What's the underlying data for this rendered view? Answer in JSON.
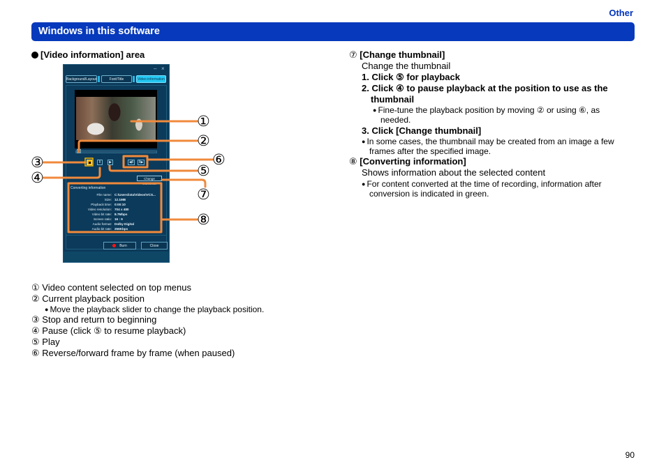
{
  "header": {
    "section": "Other",
    "title": "Windows in this software"
  },
  "area_title": "[Video information] area",
  "window": {
    "minimize_icon": "–",
    "close_icon": "×",
    "tabs": [
      {
        "label": "Background/Layout",
        "active": false
      },
      {
        "label": "Font/Title",
        "active": false
      },
      {
        "label": "Video information",
        "active": true
      }
    ],
    "controls": {
      "stop": "■",
      "pause": "II",
      "play": "▶",
      "reverse_frame": "◀II",
      "forward_frame": "II▶"
    },
    "change_thumbnail_label": "Change thumbnail",
    "converting_info": {
      "title": "Converting information",
      "rows": [
        {
          "label": "File name:",
          "value": "C:\\Users\\ista\\Videos\\VCS..."
        },
        {
          "label": "Size:",
          "value": "12.1MB"
        },
        {
          "label": "Playback time:",
          "value": "0:00:10"
        },
        {
          "label": "Video resolution:",
          "value": "704 x 480"
        },
        {
          "label": "Video bit rate:",
          "value": "8.7Mbps"
        },
        {
          "label": "Screen ratio:",
          "value": "16 : 9"
        },
        {
          "label": "Audio format:",
          "value": "Dolby Digital"
        },
        {
          "label": "Audio bit rate:",
          "value": "256Kbps"
        }
      ]
    },
    "burn_label": "Burn",
    "close_label": "Close"
  },
  "callout_numbers": [
    "①",
    "②",
    "③",
    "④",
    "⑤",
    "⑥",
    "⑦",
    "⑧"
  ],
  "legend_left": [
    {
      "num": "①",
      "text": "Video content selected on top menus"
    },
    {
      "num": "②",
      "text": "Current playback position"
    },
    {
      "bullet": "Move the playback slider to change the playback position."
    },
    {
      "num": "③",
      "text": "Stop and return to beginning"
    },
    {
      "num": "④",
      "text": "Pause (click ⑤ to resume playback)"
    },
    {
      "num": "⑤",
      "text": "Play"
    },
    {
      "num": "⑥",
      "text": "Reverse/forward frame by frame (when paused)"
    }
  ],
  "right_column": {
    "item7": {
      "num": "⑦",
      "title": "[Change thumbnail]",
      "desc": "Change the thumbnail",
      "steps": [
        "1. Click ⑤ for playback",
        "2. Click ④ to pause playback at the position to use as the",
        "thumbnail",
        "3. Click [Change thumbnail]"
      ],
      "step2_note_line1": "Fine-tune the playback position by moving ② or using ⑥, as",
      "step2_note_line2": "needed.",
      "step3_note_line1": "In some cases, the thumbnail may be created from an image a few",
      "step3_note_line2": "frames after the specified image."
    },
    "item8": {
      "num": "⑧",
      "title": "[Converting information]",
      "desc": "Shows information about the selected content",
      "note_line1": "For content converted at the time of recording, information after",
      "note_line2": "conversion is indicated in green."
    }
  },
  "page_number": "90",
  "colors": {
    "brand_blue": "#0639bc",
    "callout_orange": "#f08a3c",
    "window_bg": "#0c3a5a"
  }
}
